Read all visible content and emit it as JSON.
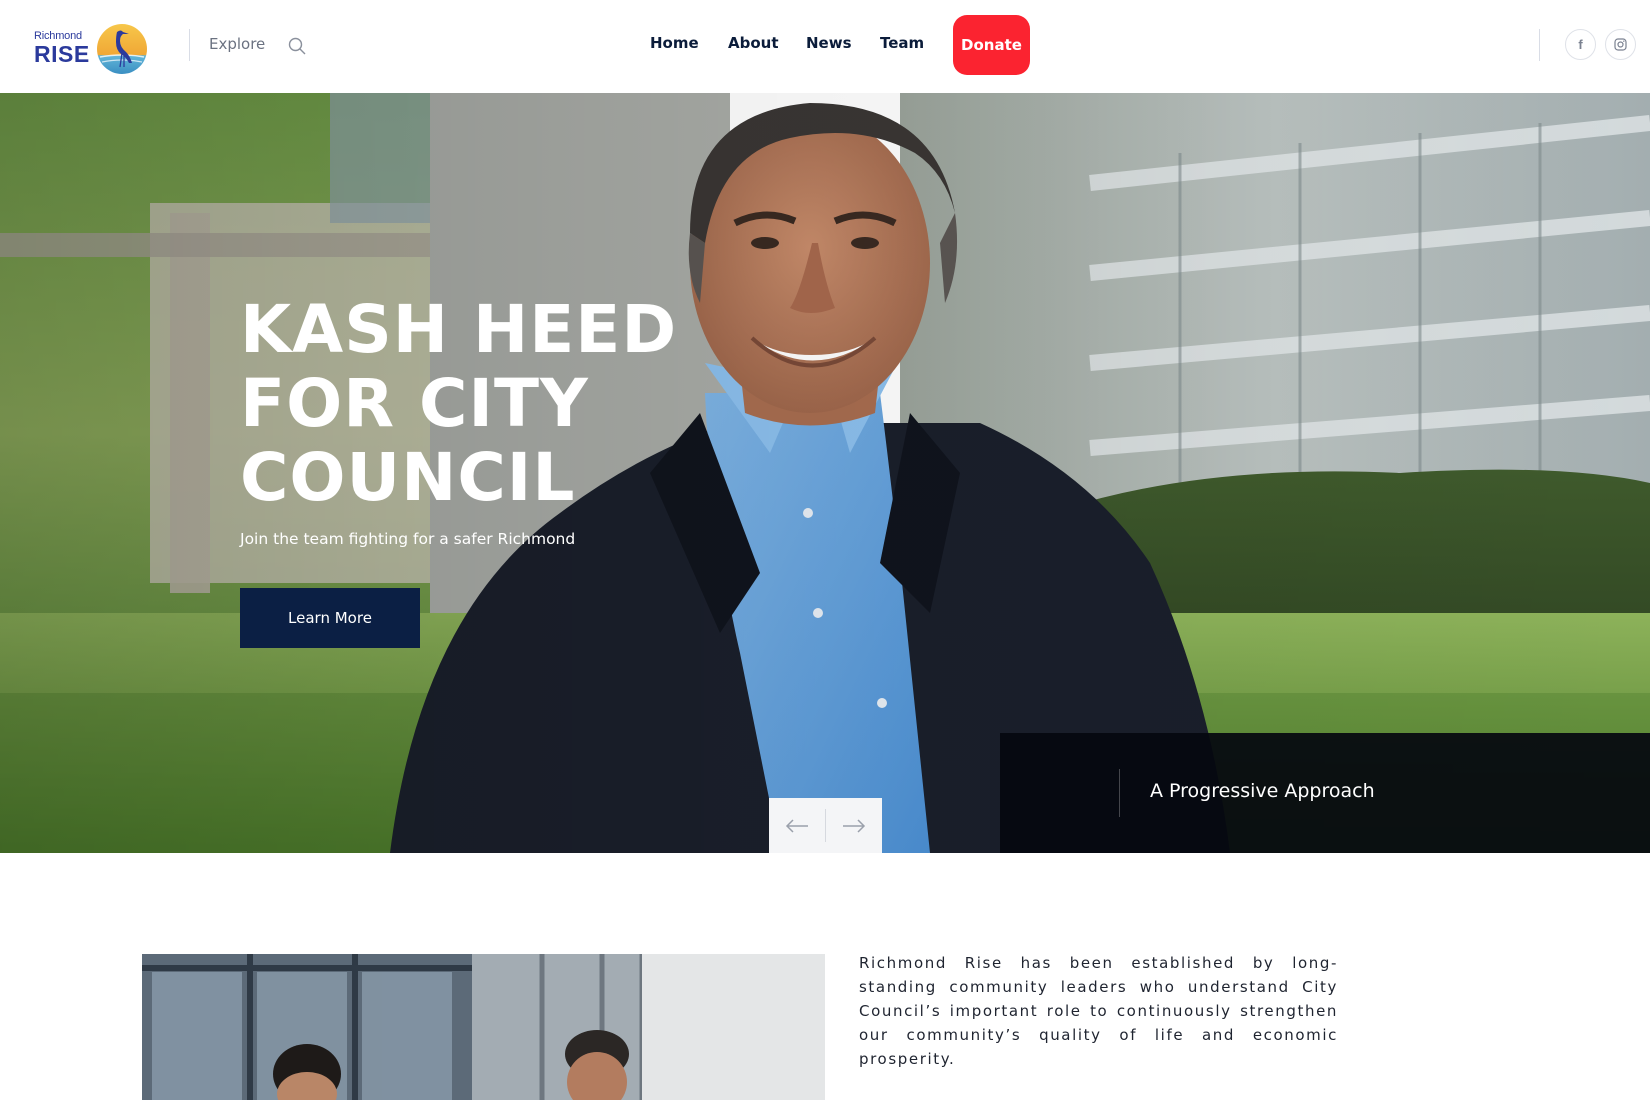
{
  "header": {
    "logo": {
      "line1": "Richmond",
      "line2": "RISE"
    },
    "explore_label": "Explore",
    "nav": [
      {
        "label": "Home"
      },
      {
        "label": "About"
      },
      {
        "label": "News"
      },
      {
        "label": "Team"
      }
    ],
    "donate_label": "Donate",
    "social": [
      {
        "icon": "facebook-icon",
        "glyph": "f"
      },
      {
        "icon": "instagram-icon"
      }
    ]
  },
  "hero": {
    "title_lines": [
      "KASH HEED",
      "FOR CITY",
      "COUNCIL"
    ],
    "subtitle": "Join the team fighting for a safer Richmond",
    "cta_label": "Learn More",
    "next_slide_label": "A Progressive Approach"
  },
  "intro": {
    "paragraph": "Richmond Rise has been established by long-standing community leaders who understand City Council’s important role to continuously strengthen our community’s quality of life and economic prosperity."
  },
  "colors": {
    "navy": "#0b1f44",
    "donate_red": "#fb2330",
    "logo_blue": "#2b3a9c"
  }
}
